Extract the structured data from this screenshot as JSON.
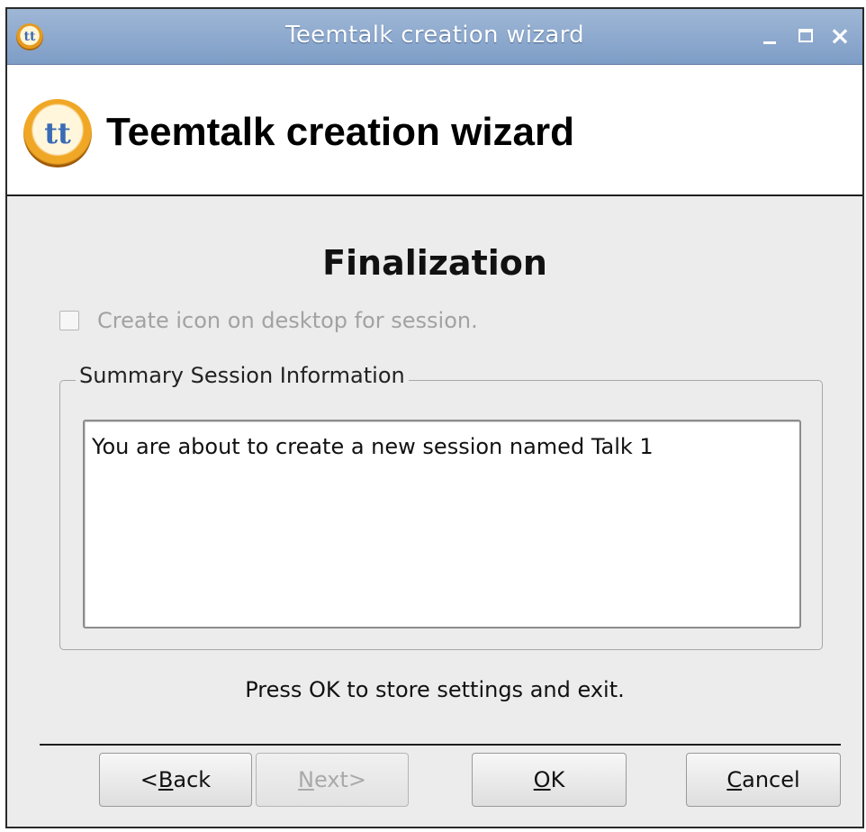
{
  "window": {
    "title": "Teemtalk creation wizard",
    "controls": {
      "close": "×"
    }
  },
  "header": {
    "logo_text": "tt",
    "title": "Teemtalk creation wizard"
  },
  "page": {
    "section_title": "Finalization",
    "checkbox": {
      "label": "Create icon on desktop for session.",
      "checked": false,
      "enabled": false
    },
    "group": {
      "legend": "Summary Session Information",
      "summary_text": "You are about to create a new session named Talk 1"
    },
    "hint": "Press OK to store settings and exit."
  },
  "buttons": {
    "back": {
      "prefix": "<",
      "mnemonic": "B",
      "rest": "ack"
    },
    "next": {
      "mnemonic": "N",
      "rest": "ext>"
    },
    "ok": {
      "mnemonic": "O",
      "rest": "K"
    },
    "cancel": {
      "mnemonic": "C",
      "rest": "ancel"
    }
  },
  "colors": {
    "titlebar": "#8aa6cc",
    "window_bg": "#ececec",
    "logo_ring": "#e59a1c",
    "logo_text": "#3a6bb5"
  }
}
